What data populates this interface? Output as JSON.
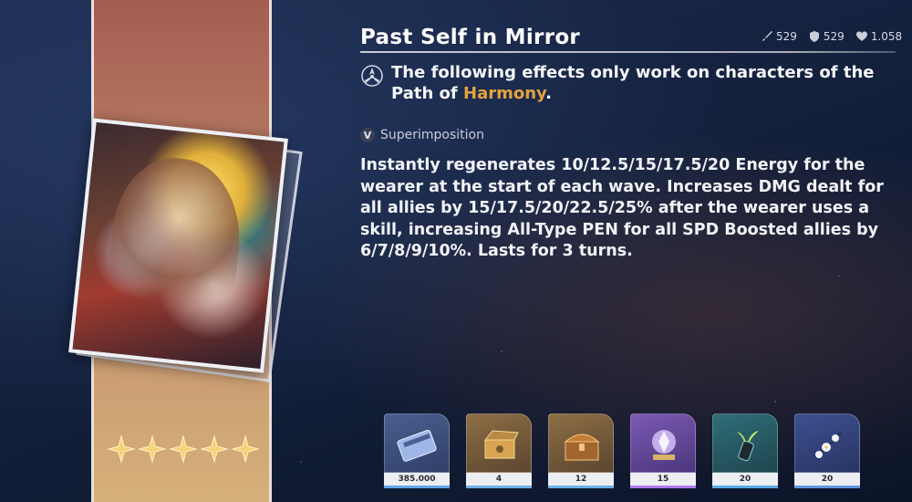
{
  "lightcone": {
    "title": "Past Self in Mirror",
    "rarity_stars": 5
  },
  "stats": {
    "attack": "529",
    "defense": "529",
    "hp": "1.058"
  },
  "path": {
    "prefix": "The following effects only work on characters of the Path of ",
    "name": "Harmony",
    "suffix": "."
  },
  "superimposition": {
    "rank": "V",
    "label": "Superimposition"
  },
  "description": "Instantly regenerates 10/12.5/15/17.5/20 Energy for the wearer at the start of each wave. Increases DMG dealt for all allies by 15/17.5/20/22.5/25% after the wearer uses a skill, increasing All-Type PEN for all SPD Boosted allies by 6/7/8/9/10%. Lasts for 3 turns.",
  "materials": [
    {
      "icon": "credit-card-icon",
      "qty": "385.000",
      "rarity": "blue"
    },
    {
      "icon": "music-box-icon",
      "qty": "4",
      "rarity": "gold"
    },
    {
      "icon": "treasure-chest-icon",
      "qty": "12",
      "rarity": "gold"
    },
    {
      "icon": "crystal-orb-icon",
      "qty": "15",
      "rarity": "purple"
    },
    {
      "icon": "sprout-vial-icon",
      "qty": "20",
      "rarity": "teal"
    },
    {
      "icon": "flower-branch-icon",
      "qty": "20",
      "rarity": "indigo"
    }
  ],
  "colors": {
    "path_highlight": "#e3a23f",
    "banner_top": "#a55d52",
    "banner_bottom": "#d6b07a"
  }
}
